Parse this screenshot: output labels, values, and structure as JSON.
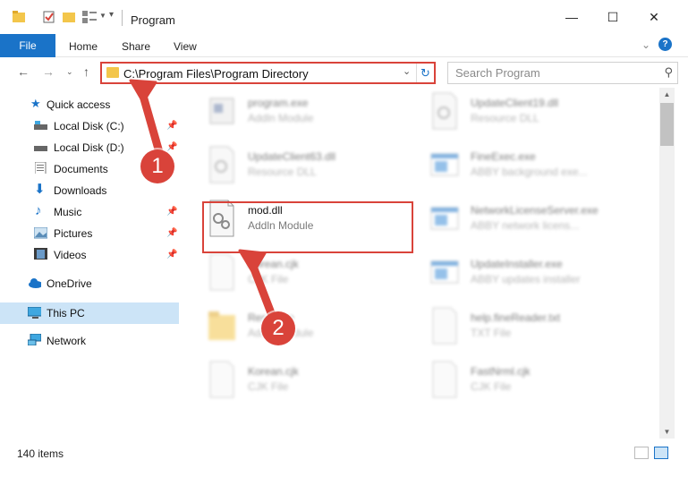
{
  "window": {
    "title": "Program",
    "minimize": "—",
    "maximize": "☐",
    "close": "✕"
  },
  "ribbon": {
    "file": "File",
    "home": "Home",
    "share": "Share",
    "view": "View",
    "help": "?"
  },
  "address": {
    "path": "C:\\Program Files\\Program Directory"
  },
  "search": {
    "placeholder": "Search Program"
  },
  "sidebar": {
    "items": [
      {
        "label": "Quick access",
        "icon": "star-icon"
      },
      {
        "label": "Local Disk (C:)",
        "icon": "drive-icon"
      },
      {
        "label": "Local Disk (D:)",
        "icon": "drive-icon"
      },
      {
        "label": "Documents",
        "icon": "documents-icon"
      },
      {
        "label": "Downloads",
        "icon": "download-icon"
      },
      {
        "label": "Music",
        "icon": "music-icon"
      },
      {
        "label": "Pictures",
        "icon": "pictures-icon"
      },
      {
        "label": "Videos",
        "icon": "videos-icon"
      },
      {
        "label": "OneDrive",
        "icon": "cloud-icon"
      },
      {
        "label": "This PC",
        "icon": "computer-icon"
      },
      {
        "label": "Network",
        "icon": "network-icon"
      }
    ]
  },
  "files": [
    {
      "name": "program.exe",
      "type": "Addln Module",
      "icon": "exe-icon"
    },
    {
      "name": "UpdateClient19.dll",
      "type": "Resource DLL",
      "icon": "dll-icon"
    },
    {
      "name": "UpdateClient63.dll",
      "type": "Resource DLL",
      "icon": "dll-icon"
    },
    {
      "name": "FineExec.exe",
      "type": "ABBY background exe...",
      "icon": "app-icon"
    },
    {
      "name": "mod.dll",
      "type": "Addln Module",
      "icon": "dll-icon"
    },
    {
      "name": "NetworkLicenseServer.exe",
      "type": "ABBY network licens...",
      "icon": "app-icon"
    },
    {
      "name": "Korean.cjk",
      "type": "CJK File",
      "icon": "file-icon"
    },
    {
      "name": "UpdateInstaller.exe",
      "type": "ABBY updates installer",
      "icon": "app-icon"
    },
    {
      "name": "Resource",
      "type": "Addln Module",
      "icon": "folder-icon"
    },
    {
      "name": "help.fineReader.txt",
      "type": "TXT File",
      "icon": "file-icon"
    },
    {
      "name": "Korean.cjk",
      "type": "CJK File",
      "icon": "file-icon"
    },
    {
      "name": "FastNrml.cjk",
      "type": "CJK File",
      "icon": "file-icon"
    }
  ],
  "annotations": {
    "step1": "1",
    "step2": "2"
  },
  "status": {
    "count": "140 items"
  },
  "colors": {
    "accent": "#1a73c8",
    "highlight": "#d9433a",
    "selected": "#cce4f7"
  }
}
